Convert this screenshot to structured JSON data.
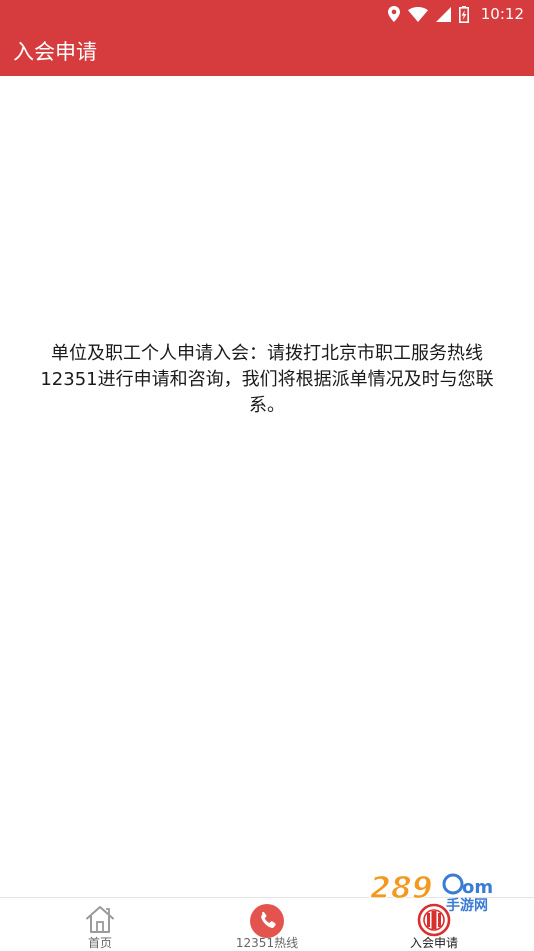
{
  "status_bar": {
    "time": "10:12",
    "icons": [
      "location-icon",
      "wifi-icon",
      "cell-signal-icon",
      "battery-icon"
    ]
  },
  "app_bar": {
    "title": "入会申请"
  },
  "main": {
    "notice_text": "单位及职工个人申请入会：请拨打北京市职工服务热线12351进行申请和咨询，我们将根据派单情况及时与您联系。"
  },
  "bottom_nav": {
    "items": [
      {
        "label": "首页",
        "icon": "home-icon",
        "active": false
      },
      {
        "label": "12351热线",
        "icon": "phone-icon",
        "active": false
      },
      {
        "label": "入会申请",
        "icon": "union-emblem-icon",
        "active": true
      }
    ]
  },
  "watermark": {
    "text": "289.com",
    "subtext": "手游网"
  },
  "colors": {
    "primary": "#d63b3d",
    "phone_icon": "#e4544f",
    "emblem": "#d9302e",
    "nav_icon_inactive": "#9a9a9a",
    "watermark_orange": "#f39a1e",
    "watermark_blue": "#3a7bd5"
  }
}
